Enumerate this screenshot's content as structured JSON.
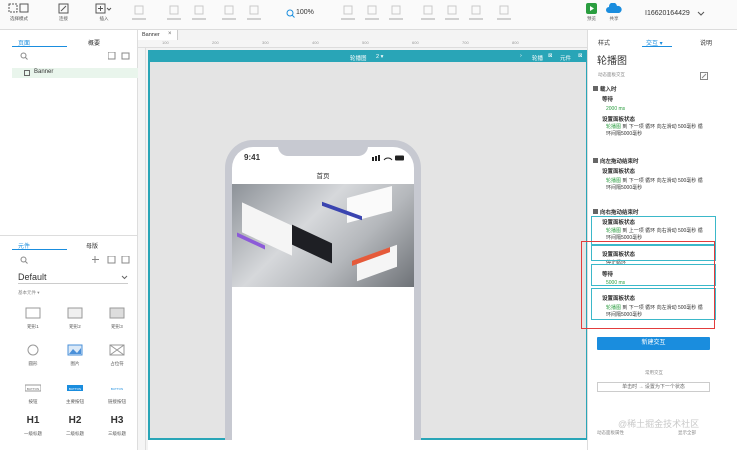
{
  "toolbar": {
    "items": [
      {
        "key": "select",
        "label": "选择模式",
        "icon": "select-icon"
      },
      {
        "key": "connect",
        "label": "连接",
        "icon": "connect-icon"
      },
      {
        "key": "insert",
        "label": "插入",
        "icon": "insert-icon"
      }
    ],
    "zoom": "100%",
    "preview": "预览",
    "share": "共享",
    "account": "I16620164429"
  },
  "left": {
    "tab_pages": "页面",
    "tab_outline": "概要",
    "page_item": "Banner",
    "tab_widgets": "元件",
    "tab_masters": "母版",
    "library": "Default",
    "section": "基本元件 ▾",
    "widgets": [
      {
        "label": "矩形1",
        "icon": "rect-icon"
      },
      {
        "label": "矩形2",
        "icon": "rect-icon"
      },
      {
        "label": "矩形3",
        "icon": "rect-icon"
      },
      {
        "label": "圆形",
        "icon": "circle-icon"
      },
      {
        "label": "图片",
        "icon": "image-icon"
      },
      {
        "label": "占位符",
        "icon": "placeholder-icon"
      },
      {
        "label": "按钮",
        "icon": "button-icon"
      },
      {
        "label": "主要按钮",
        "icon": "primary-button-icon"
      },
      {
        "label": "链接按钮",
        "icon": "link-button-icon"
      },
      {
        "label": "一级标题",
        "glyph": "H1"
      },
      {
        "label": "二级标题",
        "glyph": "H2"
      },
      {
        "label": "三级标题",
        "glyph": "H3"
      }
    ]
  },
  "canvas": {
    "tab": "Banner",
    "frame_title": "轮播图",
    "frame_states": "2 ▾",
    "frame_right_1": "轮播",
    "frame_right_2": "元件",
    "ruler_ticks": [
      "100",
      "200",
      "300",
      "400",
      "500",
      "600",
      "700",
      "800"
    ],
    "phone_time": "9:41",
    "phone_title": "首页"
  },
  "right": {
    "tab_style": "样式",
    "tab_interaction": "交互 ▾",
    "tab_notes": "说明",
    "title": "轮播图",
    "subtitle": "动态面板交互",
    "events": [
      {
        "name": "载入时",
        "actions": [
          {
            "label": "等待",
            "detail": "2000 ms"
          },
          {
            "label": "设置面板状态",
            "detail_green": "轮播图",
            "detail": "到 下一项 循环 向左滑动 500毫秒 循环间隔5000毫秒"
          }
        ]
      },
      {
        "name": "向左拖动结束时",
        "actions": [
          {
            "label": "设置面板状态",
            "detail_green": "轮播图",
            "detail": "到 下一项 循环 向左滑动 500毫秒 循环间隔5000毫秒"
          }
        ]
      },
      {
        "name": "向右拖动结束时",
        "actions": [
          {
            "label": "设置面板状态",
            "detail_green": "轮播图",
            "detail": "到 上一项 循环 向右滑动 500毫秒 循环间隔5000毫秒"
          },
          {
            "label": "设置面板状态",
            "detail": "停止循环"
          },
          {
            "label": "等待",
            "detail": "5000 ms"
          },
          {
            "label": "设置面板状态",
            "detail_green": "轮播图",
            "detail": "到 下一项 循环 向左滑动 500毫秒 循环间隔5000毫秒"
          }
        ]
      }
    ],
    "new_btn": "新建交互",
    "common": "常用交互",
    "shortcut": "单击时 → 设置为下一个状态",
    "footer_left": "动态面板属性",
    "footer_right": "显示全部"
  },
  "watermark": "@稀土掘金技术社区",
  "colors": {
    "accent": "#29a5b7",
    "primary_btn": "#1a8dde",
    "highlight": "#e23c3c",
    "green": "#2a9d3f"
  }
}
